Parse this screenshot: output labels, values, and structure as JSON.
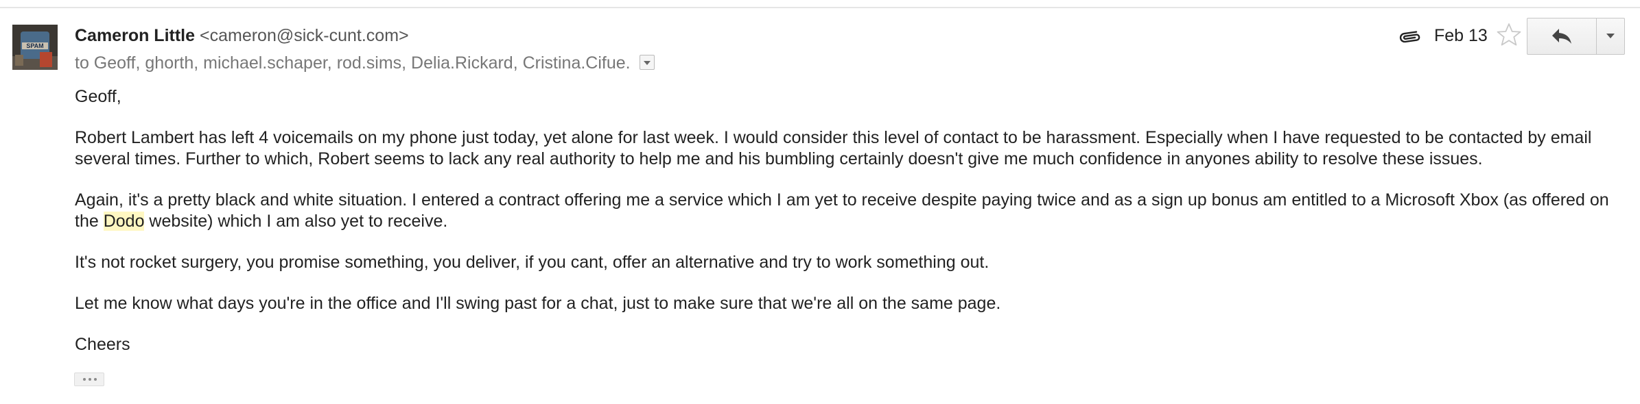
{
  "header": {
    "sender_name": "Cameron Little",
    "sender_email": "<cameron@sick-cunt.com>",
    "recipients": "to Geoff, ghorth, michael.schaper, rod.sims, Delia.Rickard, Cristina.Cifue.",
    "date": "Feb 13",
    "avatar_text": "SPAM",
    "icons": {
      "attachment": "paperclip-icon",
      "star": "star-outline-icon",
      "reply": "reply-arrow-icon",
      "more": "chevron-down-icon",
      "recipients_toggle": "chevron-down-icon"
    }
  },
  "body": {
    "greeting": "Geoff,",
    "paragraph1": "Robert Lambert has left 4 voicemails on my phone just today, yet alone for last week. I would consider this level of contact to be harassment. Especially when I have requested to be contacted by email several times. Further to which, Robert seems to lack any real authority to help me and his bumbling certainly doesn't give me much confidence in anyones ability to resolve these issues.",
    "paragraph2_before": "Again, it's a pretty black and white situation. I entered a contract offering me a service which I am yet to receive despite paying twice and as a sign up bonus am entitled to a Microsoft Xbox (as offered on the ",
    "paragraph2_highlight": "Dodo",
    "paragraph2_after": " website) which I am also yet to receive.",
    "paragraph3": "It's not rocket surgery, you promise something, you deliver, if you cant, offer an alternative and try to work something out.",
    "paragraph4": "Let me know what days you're in the office and I'll swing past for a chat, just to make sure that we're all on the same page.",
    "signoff": "Cheers"
  },
  "colors": {
    "highlight": "#fff7c2",
    "recipients_text": "#777777",
    "body_text": "#222222"
  }
}
